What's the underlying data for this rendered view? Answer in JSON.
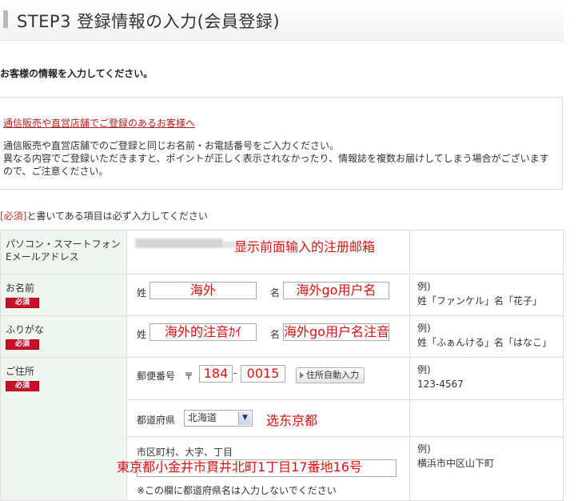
{
  "header": {
    "title": "STEP3 登録情報の入力(会員登録)"
  },
  "lead": "お客様の情報を入力してください。",
  "info": {
    "link": "通信販売や直営店舗でご登録のあるお客様へ",
    "line1": "通信販売や直営店舗でのご登録と同じお名前・お電話番号をご入力ください。",
    "line2": "異なる内容でご登録いただきますと、ポイントが正しく表示されなかったり、情報誌を複数お届けしてしまう場合がございますので、ご注意ください。"
  },
  "required_note": {
    "badge": "[必須]",
    "text": "と書いてある項目は必ず入力してください"
  },
  "badge_label": "必須",
  "rows": {
    "email": {
      "label1": "パソコン・スマートフォン",
      "label2": "Eメールアドレス",
      "annotation": "显示前面输入的注册邮箱"
    },
    "name": {
      "label": "お名前",
      "sei_label": "姓",
      "sei_value": "海外",
      "mei_label": "名",
      "mei_value": "海外go用户名",
      "ex1": "例)",
      "ex2": "姓「ファンケル」名「花子」"
    },
    "furigana": {
      "label": "ふりがな",
      "sei_label": "姓",
      "sei_value": "海外的注音ｶｲ",
      "mei_label": "名",
      "mei_value": "海外go用户名注音",
      "ex1": "例)",
      "ex2": "姓「ふぁんける」名「はなこ」"
    },
    "address": {
      "label": "ご住所",
      "zip_label": "郵便番号",
      "zip_mark": "〒",
      "zip1": "184",
      "zip_sep": "-",
      "zip2": "0015",
      "auto_button": "住所自動入力",
      "zip_ex1": "例)",
      "zip_ex2": "123-4567",
      "pref_label": "都道府県",
      "pref_value": "北海道",
      "pref_annotation": "选东京都",
      "city_label": "市区町村、大字、丁目",
      "city_value": "東京都小金井市貫井北町1丁目17番地16号",
      "city_ex1": "例)",
      "city_ex2": "横浜市中区山下町",
      "city_note": "※この欄に都道府県名は入力しないでください"
    }
  }
}
